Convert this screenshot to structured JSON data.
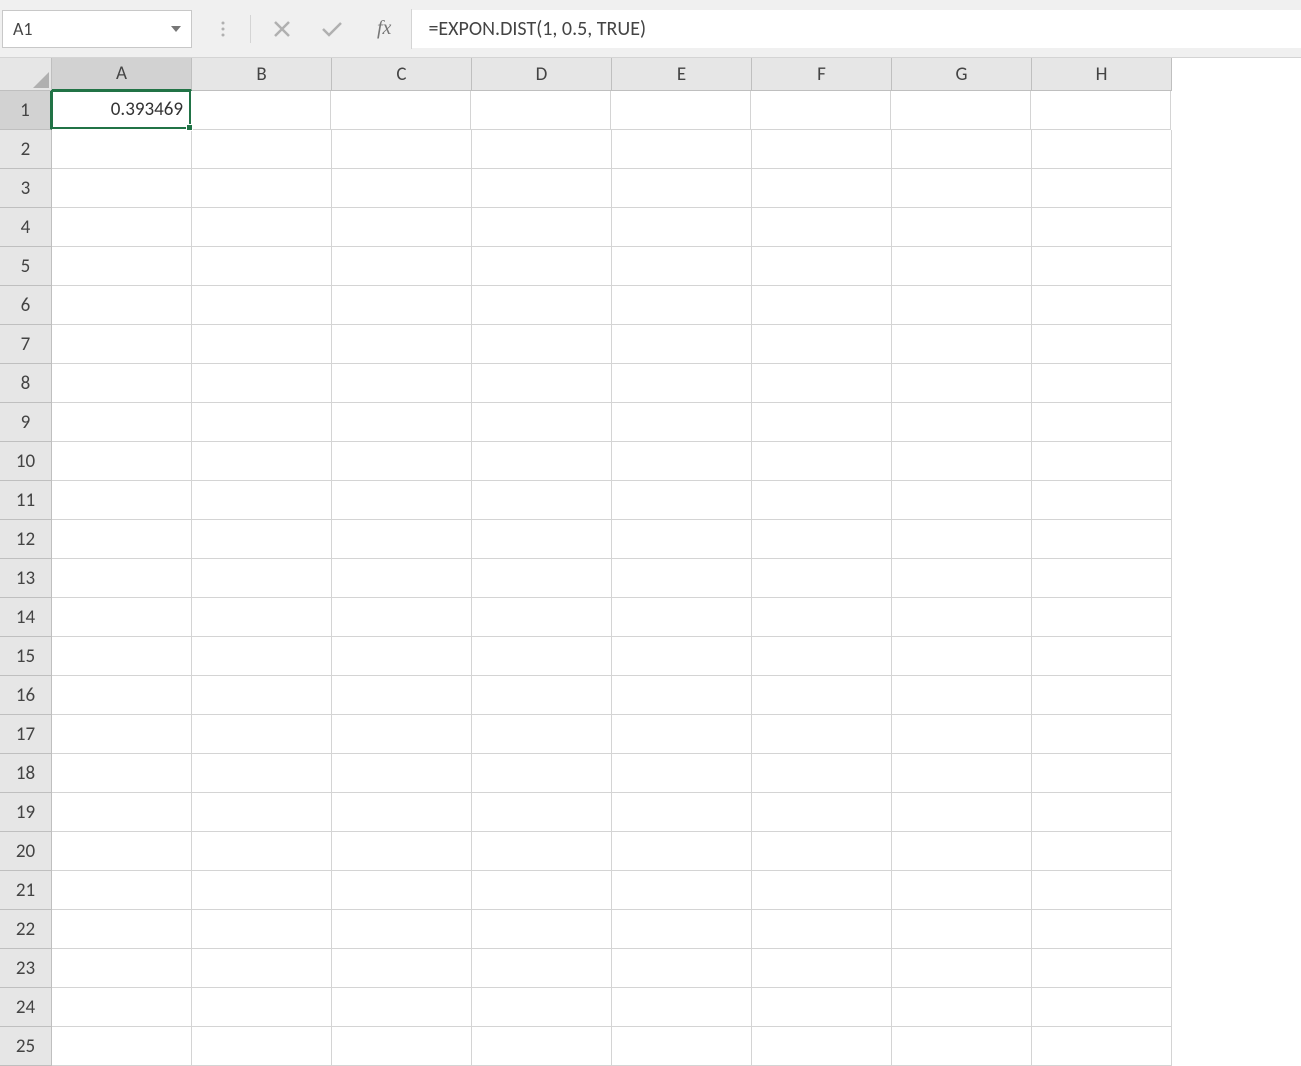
{
  "formula_bar": {
    "name_box_value": "A1",
    "fx_label": "fx",
    "formula_value": "=EXPON.DIST(1, 0.5, TRUE)"
  },
  "grid": {
    "selected_cell": "A1",
    "columns": [
      "A",
      "B",
      "C",
      "D",
      "E",
      "F",
      "G",
      "H"
    ],
    "rows": [
      "1",
      "2",
      "3",
      "4",
      "5",
      "6",
      "7",
      "8",
      "9",
      "10",
      "11",
      "12",
      "13",
      "14",
      "15",
      "16",
      "17",
      "18",
      "19",
      "20",
      "21",
      "22",
      "23",
      "24",
      "25"
    ],
    "cells": {
      "A1": "0.393469"
    }
  }
}
